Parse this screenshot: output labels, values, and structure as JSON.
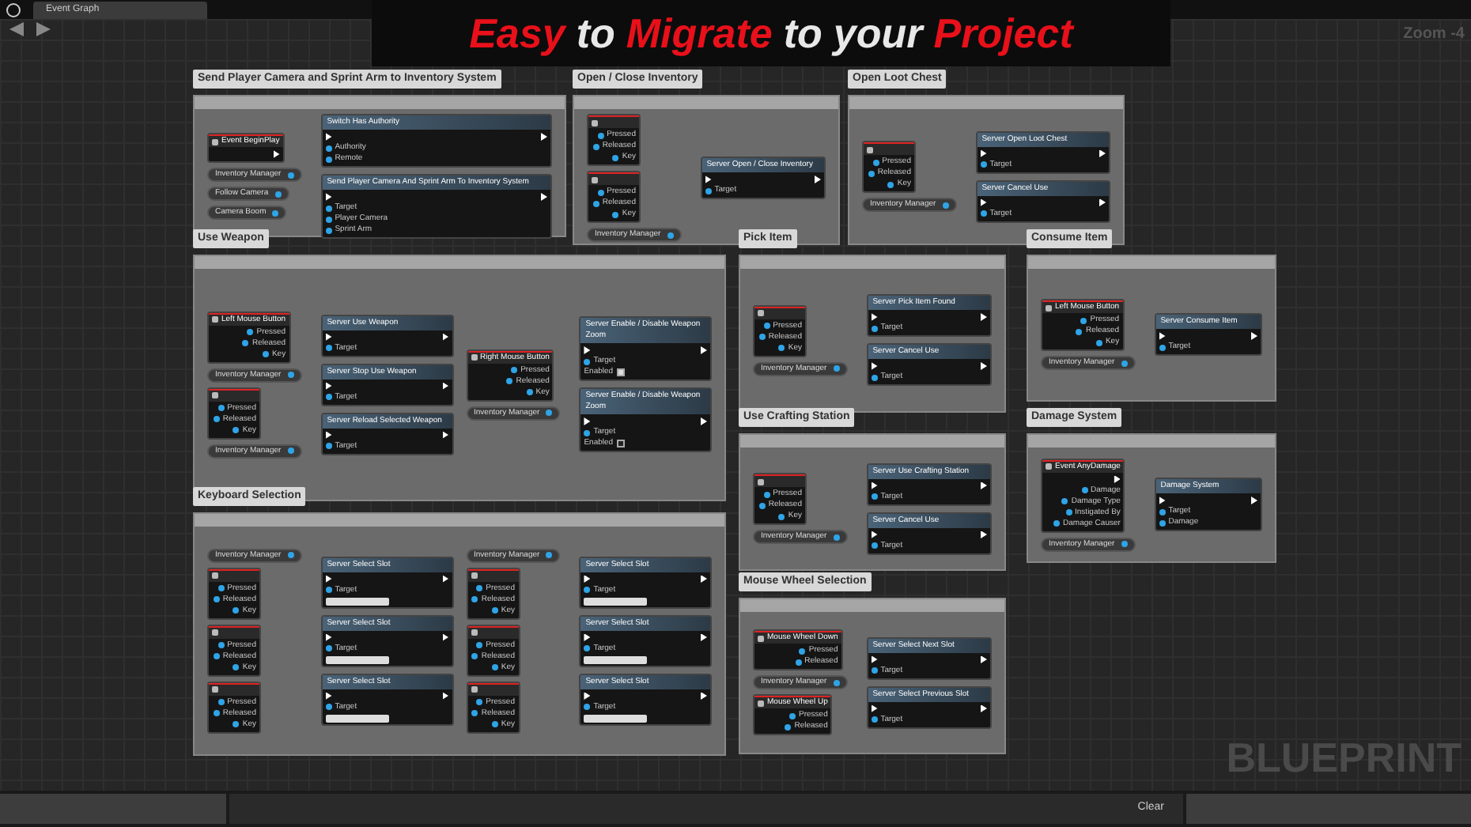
{
  "window": {
    "tab": "Event Graph",
    "zoom": "Zoom -4"
  },
  "banner": {
    "words": [
      {
        "text": "Easy",
        "accent": true
      },
      {
        "text": "to",
        "accent": false
      },
      {
        "text": "Migrate",
        "accent": true
      },
      {
        "text": "to",
        "accent": false
      },
      {
        "text": "your",
        "accent": false
      },
      {
        "text": "Project",
        "accent": true
      }
    ]
  },
  "comments": [
    {
      "label": "Send Player Camera and Sprint Arm to Inventory System",
      "groups": [
        {
          "inputs": [
            {
              "kind": "event",
              "title": "Event BeginPlay"
            },
            {
              "kind": "variable",
              "title": "Inventory Manager"
            },
            {
              "kind": "variable",
              "title": "Follow Camera"
            },
            {
              "kind": "variable",
              "title": "Camera Boom"
            }
          ],
          "functions": [
            {
              "title": "Switch Has Authority",
              "pins": [
                "Authority",
                "Remote"
              ]
            },
            {
              "title": "Send Player Camera And Sprint Arm To Inventory System",
              "pins": [
                "Target",
                "Player Camera",
                "Sprint Arm"
              ]
            }
          ]
        }
      ]
    },
    {
      "label": "Open / Close Inventory",
      "groups": [
        {
          "inputs": [
            {
              "kind": "key",
              "pins": [
                "Pressed",
                "Released",
                "Key"
              ]
            },
            {
              "kind": "key",
              "pins": [
                "Pressed",
                "Released",
                "Key"
              ]
            },
            {
              "kind": "variable",
              "title": "Inventory Manager"
            }
          ],
          "functions": [
            {
              "title": "Server Open / Close Inventory",
              "pins": [
                "Target"
              ]
            }
          ]
        }
      ]
    },
    {
      "label": "Open Loot Chest",
      "groups": [
        {
          "inputs": [
            {
              "kind": "key",
              "pins": [
                "Pressed",
                "Released",
                "Key"
              ]
            },
            {
              "kind": "variable",
              "title": "Inventory Manager"
            }
          ],
          "functions": [
            {
              "title": "Server Open Loot Chest",
              "pins": [
                "Target"
              ]
            },
            {
              "title": "Server Cancel Use",
              "pins": [
                "Target"
              ]
            }
          ]
        }
      ]
    },
    {
      "label": "Use Weapon",
      "groups": [
        {
          "inputs": [
            {
              "kind": "key",
              "title": "Left Mouse Button",
              "pins": [
                "Pressed",
                "Released",
                "Key"
              ]
            },
            {
              "kind": "variable",
              "title": "Inventory Manager"
            },
            {
              "kind": "key",
              "pins": [
                "Pressed",
                "Released",
                "Key"
              ]
            },
            {
              "kind": "variable",
              "title": "Inventory Manager"
            }
          ],
          "functions": [
            {
              "title": "Server Use Weapon",
              "pins": [
                "Target"
              ]
            },
            {
              "title": "Server Stop Use Weapon",
              "pins": [
                "Target"
              ]
            },
            {
              "title": "Server Reload Selected Weapon",
              "pins": [
                "Target"
              ]
            }
          ]
        },
        {
          "inputs": [
            {
              "kind": "key",
              "title": "Right Mouse Button",
              "pins": [
                "Pressed",
                "Released",
                "Key"
              ]
            },
            {
              "kind": "variable",
              "title": "Inventory Manager"
            }
          ],
          "functions": [
            {
              "title": "Server Enable / Disable Weapon Zoom",
              "pins": [
                "Target"
              ],
              "toggle": {
                "label": "Enabled",
                "checked": true
              }
            },
            {
              "title": "Server Enable / Disable Weapon Zoom",
              "pins": [
                "Target"
              ],
              "toggle": {
                "label": "Enabled",
                "checked": false
              }
            }
          ]
        }
      ]
    },
    {
      "label": "Pick Item",
      "groups": [
        {
          "inputs": [
            {
              "kind": "key",
              "pins": [
                "Pressed",
                "Released",
                "Key"
              ]
            },
            {
              "kind": "variable",
              "title": "Inventory Manager"
            }
          ],
          "functions": [
            {
              "title": "Server Pick Item Found",
              "pins": [
                "Target"
              ]
            },
            {
              "title": "Server Cancel Use",
              "pins": [
                "Target"
              ]
            }
          ]
        }
      ]
    },
    {
      "label": "Consume Item",
      "groups": [
        {
          "inputs": [
            {
              "kind": "key",
              "title": "Left Mouse Button",
              "pins": [
                "Pressed",
                "Released",
                "Key"
              ]
            },
            {
              "kind": "variable",
              "title": "Inventory Manager"
            }
          ],
          "functions": [
            {
              "title": "Server Consume Item",
              "pins": [
                "Target"
              ]
            }
          ]
        }
      ]
    },
    {
      "label": "Use Crafting Station",
      "groups": [
        {
          "inputs": [
            {
              "kind": "key",
              "pins": [
                "Pressed",
                "Released",
                "Key"
              ]
            },
            {
              "kind": "variable",
              "title": "Inventory Manager"
            }
          ],
          "functions": [
            {
              "title": "Server Use Crafting Station",
              "pins": [
                "Target"
              ]
            },
            {
              "title": "Server Cancel Use",
              "pins": [
                "Target"
              ]
            }
          ]
        }
      ]
    },
    {
      "label": "Damage System",
      "groups": [
        {
          "inputs": [
            {
              "kind": "event",
              "title": "Event AnyDamage",
              "pins": [
                "Damage",
                "Damage Type",
                "Instigated By",
                "Damage Causer"
              ]
            },
            {
              "kind": "variable",
              "title": "Inventory Manager"
            }
          ],
          "functions": [
            {
              "title": "Damage System",
              "pins": [
                "Target",
                "Damage"
              ]
            }
          ]
        }
      ]
    },
    {
      "label": "Keyboard Selection",
      "groups": [
        {
          "inputs": [
            {
              "kind": "variable",
              "title": "Inventory Manager"
            },
            {
              "kind": "key",
              "pins": [
                "Pressed",
                "Released",
                "Key"
              ]
            },
            {
              "kind": "key",
              "pins": [
                "Pressed",
                "Released",
                "Key"
              ]
            },
            {
              "kind": "key",
              "pins": [
                "Pressed",
                "Released",
                "Key"
              ]
            }
          ],
          "functions": [
            {
              "title": "Server Select Slot",
              "pins": [
                "Target"
              ],
              "enum_field": true
            },
            {
              "title": "Server Select Slot",
              "pins": [
                "Target"
              ],
              "enum_field": true
            },
            {
              "title": "Server Select Slot",
              "pins": [
                "Target"
              ],
              "enum_field": true
            }
          ]
        },
        {
          "inputs": [
            {
              "kind": "variable",
              "title": "Inventory Manager"
            },
            {
              "kind": "key",
              "pins": [
                "Pressed",
                "Released",
                "Key"
              ]
            },
            {
              "kind": "key",
              "pins": [
                "Pressed",
                "Released",
                "Key"
              ]
            },
            {
              "kind": "key",
              "pins": [
                "Pressed",
                "Released",
                "Key"
              ]
            }
          ],
          "functions": [
            {
              "title": "Server Select Slot",
              "pins": [
                "Target"
              ],
              "enum_field": true
            },
            {
              "title": "Server Select Slot",
              "pins": [
                "Target"
              ],
              "enum_field": true
            },
            {
              "title": "Server Select Slot",
              "pins": [
                "Target"
              ],
              "enum_field": true
            }
          ]
        }
      ]
    },
    {
      "label": "Mouse Wheel Selection",
      "groups": [
        {
          "inputs": [
            {
              "kind": "key",
              "title": "Mouse Wheel Down",
              "pins": [
                "Pressed",
                "Released"
              ]
            },
            {
              "kind": "variable",
              "title": "Inventory Manager"
            },
            {
              "kind": "key",
              "title": "Mouse Wheel Up",
              "pins": [
                "Pressed",
                "Released"
              ]
            }
          ],
          "functions": [
            {
              "title": "Server Select Next Slot",
              "pins": [
                "Target"
              ]
            },
            {
              "title": "Server Select Previous Slot",
              "pins": [
                "Target"
              ]
            }
          ]
        }
      ]
    }
  ],
  "watermark": "BLUEPRINT",
  "status_bar": {
    "button": "Clear"
  }
}
